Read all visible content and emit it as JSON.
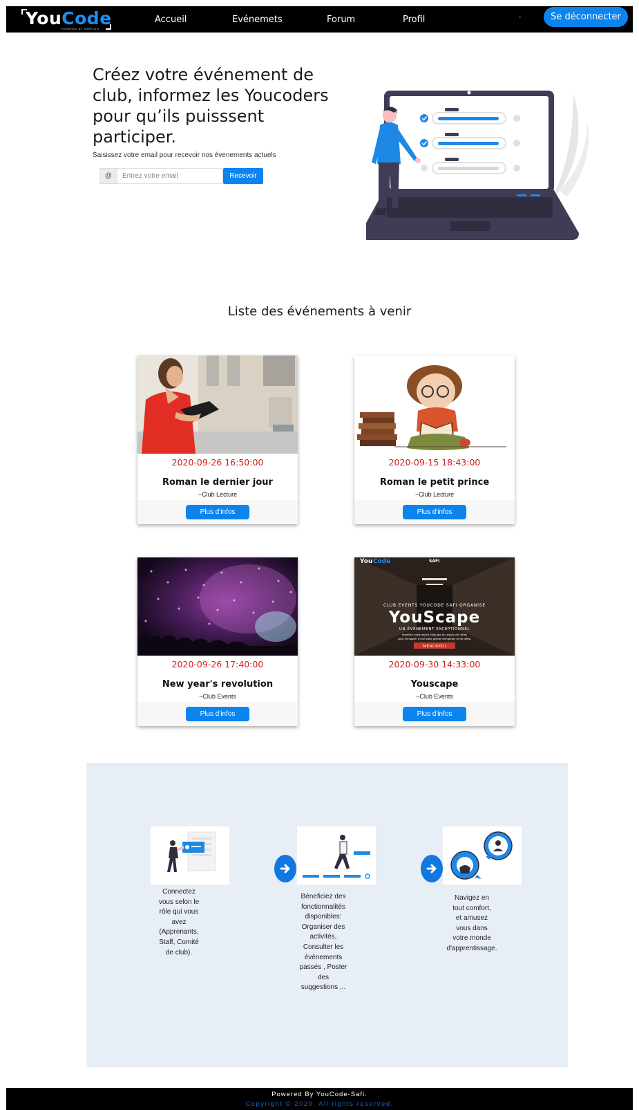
{
  "nav": {
    "logo_you": "You",
    "logo_code": "Code",
    "logo_tagline": "POWERED BY SIMPLON",
    "links": [
      "Accueil",
      "Evénemets",
      "Forum",
      "Profil"
    ],
    "logout_label": "Se déconnecter"
  },
  "hero": {
    "title": "Créez votre événement de club, informez les Youcoders pour qu’ils puisssent participer.",
    "subtitle": "Saisissez votre email pour recevoir nos évenements actuels",
    "email_addon": "@",
    "email_placeholder": "Entrez votre email",
    "submit_label": "Recevoir"
  },
  "events": {
    "title": "Liste des événements à venir",
    "button_label": "Plus d'infos",
    "items": [
      {
        "date": "2020-09-26 16:50:00",
        "title": "Roman le dernier jour",
        "club": "~Club Lecture",
        "image": "woman-reading-photo"
      },
      {
        "date": "2020-09-15 18:43:00",
        "title": "Roman le petit prince",
        "club": "~Club Lecture",
        "image": "boy-reading-illustration"
      },
      {
        "date": "2020-09-26 17:40:00",
        "title": "New year's revolution",
        "club": "~Club Events",
        "image": "confetti-concert-photo"
      },
      {
        "date": "2020-09-30 14:33:00",
        "title": "Youscape",
        "club": "~Club Events",
        "image": "youscape-poster"
      }
    ],
    "poster": {
      "logo_you": "You",
      "logo_code": "Code",
      "logo_safi": "SAFI",
      "org": "CLUB EVENTS YOUCODE SAFI ORGANISE",
      "name": "YouScape",
      "tagline": "UN ÉVÉNEMENT EXCEPTIONNEL",
      "line1": "réveillez votre esprit d'équipe et cassez vos têtes",
      "line2": "pour échapper d'une salle pleine d'énigmes et de défis!",
      "day": "MERCREDI"
    }
  },
  "features": {
    "steps": [
      {
        "text_lines": [
          "Connectez",
          "vous selon le",
          "rôle qui vous",
          "avez",
          "(Apprenants,",
          "Staff, Comité",
          "de club)."
        ]
      },
      {
        "text_lines": [
          "Béneficiez des",
          "fonctionnalités",
          "disponibles:",
          "Organiser des",
          "activités,",
          "Consulter les",
          "événements",
          "passés , Poster",
          "des",
          "suggestions ..."
        ]
      },
      {
        "text_lines": [
          "Navigez en",
          "tout comfort,",
          "et amusez",
          "vous dans",
          "votre monde",
          "d'apprentissage."
        ]
      }
    ]
  },
  "footer": {
    "powered": "Powered By YouCode-Safi.",
    "copyright": "Copyright © 2020. All rights reserved."
  },
  "colors": {
    "accent": "#0b84ee",
    "date_red": "#d0211b",
    "features_bg": "#e8eef6",
    "footer_link": "#1b63c8"
  }
}
